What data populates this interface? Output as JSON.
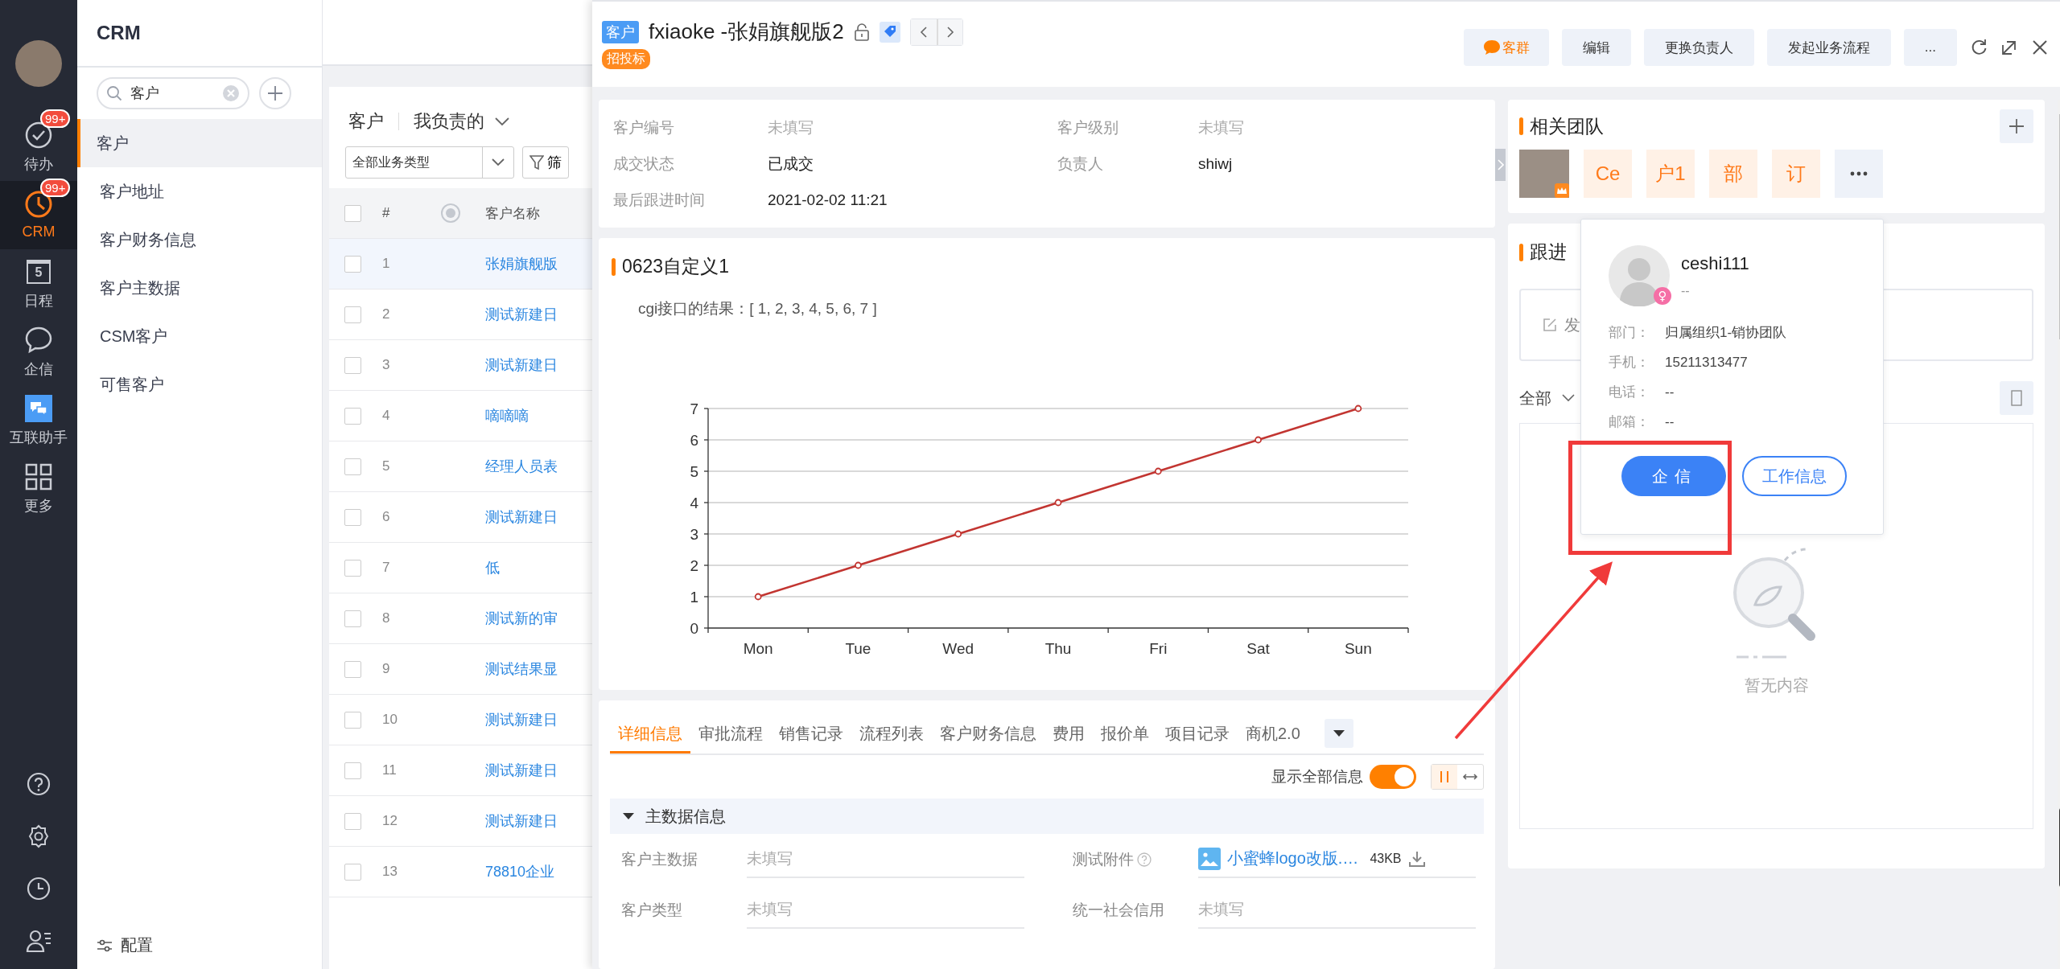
{
  "nav": {
    "items": [
      {
        "kind": "todo",
        "label": "待办",
        "badge": "99+",
        "selected": false
      },
      {
        "kind": "crm",
        "label": "CRM",
        "badge": "99+",
        "selected": true
      },
      {
        "kind": "calendar",
        "label": "日程",
        "day": "5",
        "selected": false
      },
      {
        "kind": "chat",
        "label": "企信",
        "selected": false
      },
      {
        "kind": "helper",
        "label": "互联助手",
        "selected": false
      },
      {
        "kind": "more",
        "label": "更多",
        "selected": false
      }
    ]
  },
  "sidebar": {
    "title": "CRM",
    "search": {
      "value": "客户"
    },
    "items": [
      {
        "label": "客户",
        "selected": true
      },
      {
        "label": "客户地址",
        "selected": false
      },
      {
        "label": "客户财务信息",
        "selected": false
      },
      {
        "label": "客户主数据",
        "selected": false
      },
      {
        "label": "CSM客户",
        "selected": false
      },
      {
        "label": "可售客户",
        "selected": false
      }
    ],
    "footer": "配置"
  },
  "list": {
    "title": "客户",
    "view": "我负责的",
    "type_select": "全部业务类型",
    "filter": "筛",
    "select_all": {
      "checked": false
    },
    "columns": [
      "#",
      "客户名称"
    ],
    "rows": [
      {
        "index": "1",
        "name": "张娟旗舰版",
        "selected": true,
        "checked": false
      },
      {
        "index": "2",
        "name": "测试新建日",
        "selected": false,
        "checked": false
      },
      {
        "index": "3",
        "name": "测试新建日",
        "selected": false,
        "checked": false
      },
      {
        "index": "4",
        "name": "嘀嘀嘀",
        "selected": false,
        "checked": false
      },
      {
        "index": "5",
        "name": "经理人员表",
        "selected": false,
        "checked": false
      },
      {
        "index": "6",
        "name": "测试新建日",
        "selected": false,
        "checked": false
      },
      {
        "index": "7",
        "name": "低",
        "selected": false,
        "checked": false
      },
      {
        "index": "8",
        "name": "测试新的审",
        "selected": false,
        "checked": false
      },
      {
        "index": "9",
        "name": "测试结果显",
        "selected": false,
        "checked": false
      },
      {
        "index": "10",
        "name": "测试新建日",
        "selected": false,
        "checked": false
      },
      {
        "index": "11",
        "name": "测试新建日",
        "selected": false,
        "checked": false
      },
      {
        "index": "12",
        "name": "测试新建日",
        "selected": false,
        "checked": false
      },
      {
        "index": "13",
        "name": "78810企业",
        "selected": false,
        "checked": false
      }
    ]
  },
  "drawer": {
    "object_tag": "客户",
    "title": "fxiaoke -张娟旗舰版2",
    "badge": "招投标",
    "actions": [
      {
        "kind": "chat",
        "label": "客群"
      },
      {
        "kind": "plain",
        "label": "编辑"
      },
      {
        "kind": "plain",
        "label": "更换负责人"
      },
      {
        "kind": "plain",
        "label": "发起业务流程"
      },
      {
        "kind": "plain",
        "label": "..."
      }
    ],
    "info": [
      {
        "label": "客户编号",
        "value": "未填写",
        "filled": false
      },
      {
        "label": "客户级别",
        "value": "未填写",
        "filled": false
      },
      {
        "label": "成交状态",
        "value": "已成交",
        "filled": true
      },
      {
        "label": "负责人",
        "value": "shiwj",
        "filled": true
      },
      {
        "label": "最后跟进时间",
        "value": "2021-02-02 11:21",
        "filled": true
      }
    ],
    "chart_card": {
      "title": "0623自定义1",
      "result": "cgi接口的结果：[ 1, 2, 3, 4, 5, 6, 7 ]",
      "chart_data": {
        "type": "line",
        "categories": [
          "Mon",
          "Tue",
          "Wed",
          "Thu",
          "Fri",
          "Sat",
          "Sun"
        ],
        "values": [
          1,
          2,
          3,
          4,
          5,
          6,
          7
        ],
        "ylim": [
          0,
          7
        ],
        "yticks": [
          0,
          1,
          2,
          3,
          4,
          5,
          6,
          7
        ],
        "grid": true,
        "marker": true
      }
    },
    "details": {
      "tabs": [
        {
          "label": "详细信息",
          "selected": true
        },
        {
          "label": "审批流程",
          "selected": false
        },
        {
          "label": "销售记录",
          "selected": false
        },
        {
          "label": "流程列表",
          "selected": false
        },
        {
          "label": "客户财务信息",
          "selected": false
        },
        {
          "label": "费用",
          "selected": false
        },
        {
          "label": "报价单",
          "selected": false
        },
        {
          "label": "项目记录",
          "selected": false
        },
        {
          "label": "商机2.0",
          "selected": false
        }
      ],
      "show_all": {
        "label": "显示全部信息",
        "on": true
      },
      "layout_modes": [
        {
          "kind": "columns",
          "selected": true
        },
        {
          "kind": "wide",
          "selected": false
        }
      ],
      "section": {
        "title": "主数据信息",
        "expanded": true
      },
      "fields": [
        {
          "kind": "text",
          "label": "客户主数据",
          "value": "未填写"
        },
        {
          "kind": "file",
          "label": "测试附件",
          "help": true,
          "file_name": "小蜜蜂logo改版.…",
          "file_size": "43KB"
        },
        {
          "kind": "text",
          "label": "客户类型",
          "value": "未填写"
        },
        {
          "kind": "text",
          "label": "统一社会信用",
          "value": "未填写"
        }
      ]
    }
  },
  "team": {
    "title": "相关团队",
    "members": [
      {
        "kind": "photo",
        "owner": true
      },
      {
        "kind": "tile",
        "label": "Ce"
      },
      {
        "kind": "tile",
        "label": "户1"
      },
      {
        "kind": "tile",
        "label": "部"
      },
      {
        "kind": "tile",
        "label": "订"
      },
      {
        "kind": "more"
      }
    ]
  },
  "follow": {
    "title": "跟进",
    "compose": "发",
    "filter": "全部",
    "empty": "暂无内容"
  },
  "popover": {
    "name": "ceshi111",
    "subtitle": "--",
    "gender_symbol": "♀",
    "details": [
      {
        "label": "部门：",
        "value": "归属组织1-销协团队"
      },
      {
        "label": "手机：",
        "value": "15211313477"
      },
      {
        "label": "电话：",
        "value": "--"
      },
      {
        "label": "邮箱：",
        "value": "--"
      }
    ],
    "buttons": [
      {
        "kind": "primary",
        "label": "企信"
      },
      {
        "kind": "outline",
        "label": "工作信息"
      }
    ]
  }
}
